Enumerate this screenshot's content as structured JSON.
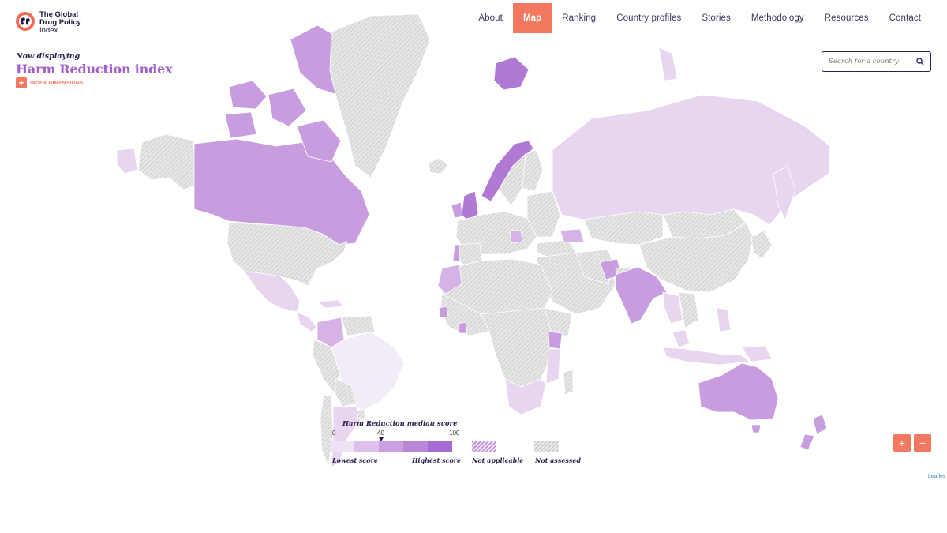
{
  "header": {
    "logo_line1": "The Global",
    "logo_line2": "Drug Policy",
    "logo_line3": "Index",
    "nav": [
      {
        "label": "About"
      },
      {
        "label": "Map",
        "active": true
      },
      {
        "label": "Ranking"
      },
      {
        "label": "Country profiles"
      },
      {
        "label": "Stories"
      },
      {
        "label": "Methodology"
      },
      {
        "label": "Resources"
      },
      {
        "label": "Contact"
      }
    ]
  },
  "panel": {
    "now_displaying": "Now displaying",
    "index_title": "Harm Reduction index",
    "index_dimensions": "INDEX DIMENSIONS"
  },
  "search": {
    "placeholder": "Search for a country"
  },
  "legend": {
    "title": "Harm Reduction median score",
    "tick_min": "0",
    "tick_median": "40",
    "tick_max": "100",
    "median_value": 40,
    "lowest_label": "Lowest score",
    "highest_label": "Highest score",
    "not_applicable": "Not applicable",
    "not_assessed": "Not assessed",
    "scale_colors": [
      "#efe2f6",
      "#dcc1ec",
      "#caa0e1",
      "#b887d8",
      "#a56bcf"
    ]
  },
  "colors": {
    "accent": "#f2785f",
    "title_purple": "#a45ec8",
    "navy": "#2a2250",
    "not_assessed": "#dcdcdc",
    "pale": "#e8d6f0",
    "light": "#d5b3e6",
    "mid": "#c79ddf",
    "strong": "#b079d3"
  },
  "zoom": {
    "in": "+",
    "out": "−"
  },
  "attribution": "Leaflet"
}
